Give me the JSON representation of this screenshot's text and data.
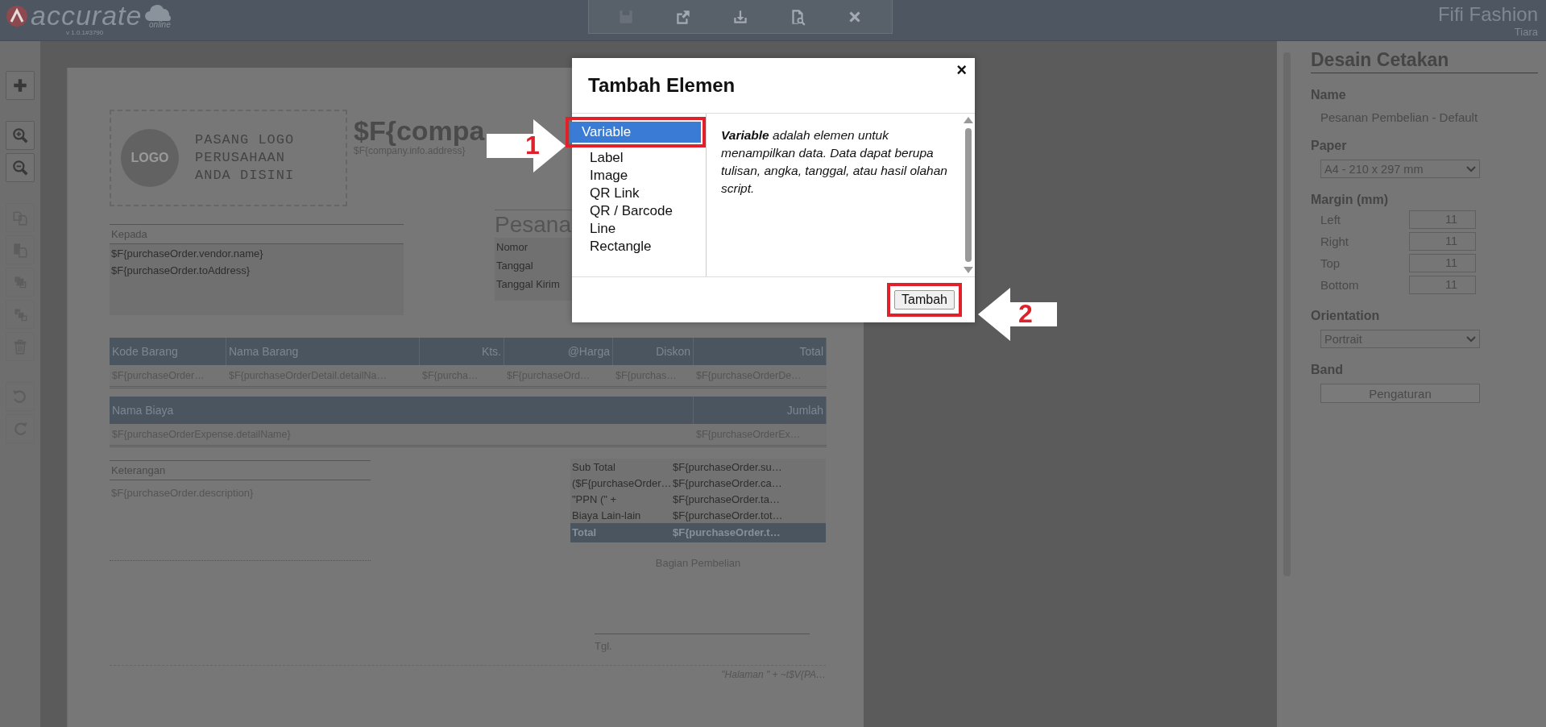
{
  "header": {
    "logo": "accurate",
    "logo_sub": "online",
    "version": "v 1.0.1#3790",
    "company": "Fifi Fashion",
    "user": "Tiara"
  },
  "top_tools": [
    {
      "kind": "save",
      "disabled": true
    },
    {
      "kind": "export",
      "disabled": false
    },
    {
      "kind": "download",
      "disabled": false
    },
    {
      "kind": "preview",
      "disabled": false
    },
    {
      "kind": "close",
      "disabled": false
    }
  ],
  "side_tools": [
    {
      "kind": "add",
      "disabled": false
    },
    {
      "kind": "zoom_in",
      "disabled": false
    },
    {
      "kind": "zoom_out",
      "disabled": false
    },
    {
      "kind": "copy",
      "disabled": true
    },
    {
      "kind": "paste",
      "disabled": true
    },
    {
      "kind": "front",
      "disabled": true
    },
    {
      "kind": "back",
      "disabled": true
    },
    {
      "kind": "delete",
      "disabled": true
    },
    {
      "kind": "undo",
      "disabled": true
    },
    {
      "kind": "redo",
      "disabled": true
    }
  ],
  "page": {
    "logo_badge": "LOGO",
    "logo_hint": "PASANG LOGO PERUSAHAAN ANDA DISINI",
    "company_name": "$F{compa",
    "company_address": "$F{company.info.address}",
    "to_label": "Kepada",
    "to_lines": [
      "$F{purchaseOrder.vendor.name}",
      "$F{purchaseOrder.toAddress}"
    ],
    "doc_title": "Pesana",
    "doc_fields": [
      "Nomor",
      "Tanggal",
      "Tanggal Kirim"
    ],
    "items": {
      "columns": [
        "Kode Barang",
        "Nama Barang",
        "Kts.",
        "@Harga",
        "Diskon",
        "Total"
      ],
      "row": [
        "$F{purchaseOrder…",
        "$F{purchaseOrderDetail.detailNa…",
        "$F{purcha…",
        "$F{purchaseOrd…",
        "$F{purchas…",
        "$F{purchaseOrderDe…"
      ]
    },
    "expenses": {
      "columns": [
        "Nama Biaya",
        "Jumlah"
      ],
      "row": [
        "$F{purchaseOrderExpense.detailName}",
        "$F{purchaseOrderEx…"
      ]
    },
    "notes_label": "Keterangan",
    "notes_value": "$F{purchaseOrder.description}",
    "totals": [
      {
        "kind": "line",
        "label": "Sub Total",
        "value": "$F{purchaseOrder.su…"
      },
      {
        "kind": "line",
        "label": "($F{purchaseOrder…",
        "value": "$F{purchaseOrder.ca…"
      },
      {
        "kind": "line",
        "label": "\"PPN (\" +",
        "value": "$F{purchaseOrder.ta…"
      },
      {
        "kind": "line",
        "label": "Biaya Lain-lain",
        "value": "$F{purchaseOrder.tot…"
      },
      {
        "kind": "total",
        "label": "Total",
        "value": "$F{purchaseOrder.t…"
      }
    ],
    "signature_title": "Bagian Pembelian",
    "signature_date": "Tgl.",
    "footer": "\"Halaman \" + ~t$V{PA…"
  },
  "dialog": {
    "title": "Tambah Elemen",
    "close": "×",
    "items": [
      {
        "label": "Variable",
        "selected": true
      },
      {
        "label": "Label",
        "selected": false
      },
      {
        "label": "Image",
        "selected": false
      },
      {
        "label": "QR Link",
        "selected": false
      },
      {
        "label": "QR / Barcode",
        "selected": false
      },
      {
        "label": "Line",
        "selected": false
      },
      {
        "label": "Rectangle",
        "selected": false
      }
    ],
    "description": "**Variable** adalah elemen untuk menampilkan data. Data dapat berupa tulisan, angka, tanggal, atau hasil olahan script.",
    "button": "Tambah"
  },
  "properties": {
    "title": "Desain Cetakan",
    "name_label": "Name",
    "name_value": "Pesanan Pembelian - Default",
    "paper_label": "Paper",
    "paper_value": "A4 - 210 x 297 mm",
    "margin_label": "Margin (mm)",
    "margins": [
      {
        "label": "Left",
        "value": "11"
      },
      {
        "label": "Right",
        "value": "11"
      },
      {
        "label": "Top",
        "value": "11"
      },
      {
        "label": "Bottom",
        "value": "11"
      }
    ],
    "orientation_label": "Orientation",
    "orientation_value": "Portrait",
    "band_label": "Band",
    "band_button": "Pengaturan"
  },
  "annotations": [
    {
      "label": "1"
    },
    {
      "label": "2"
    }
  ]
}
